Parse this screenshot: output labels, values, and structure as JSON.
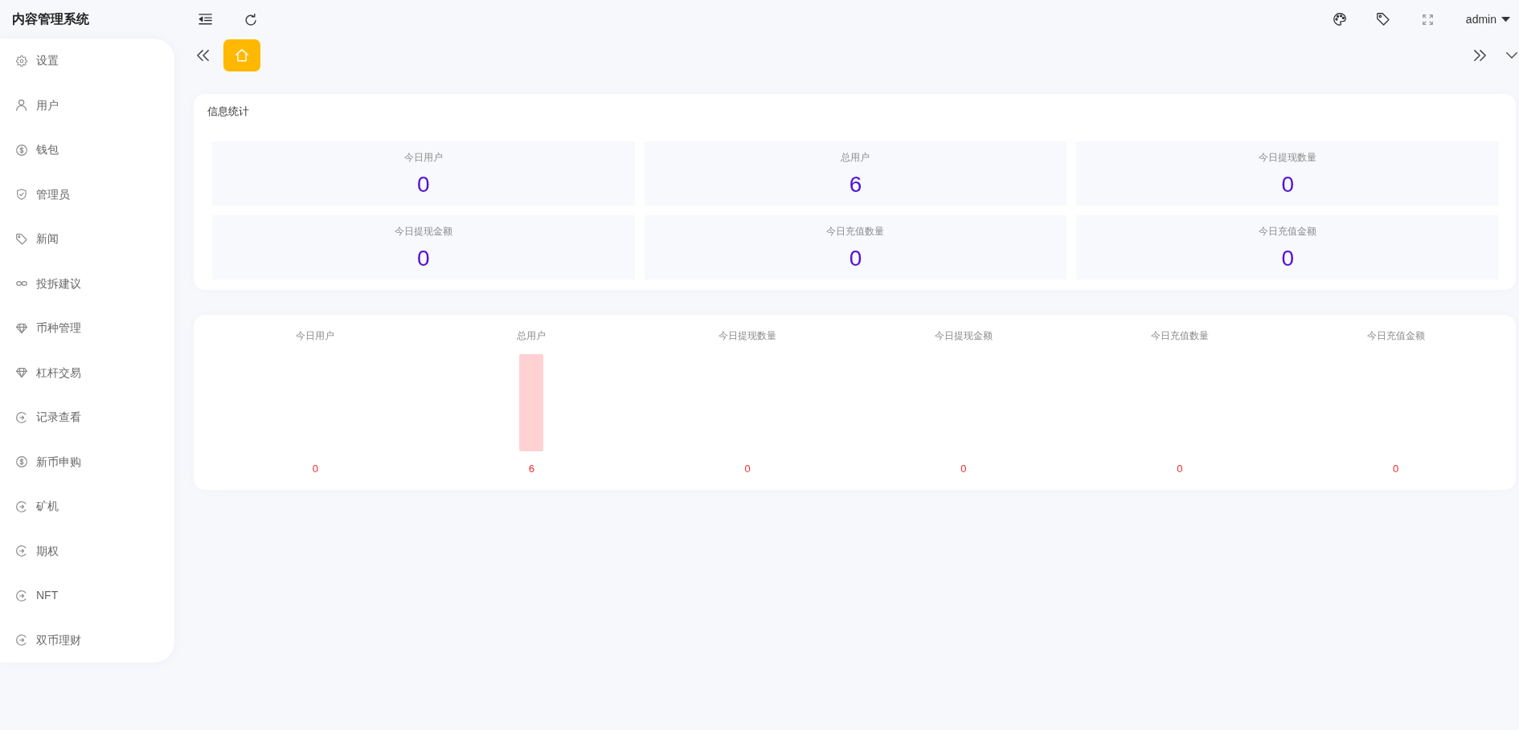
{
  "header": {
    "title": "内容管理系统",
    "user": "admin"
  },
  "sidebar": {
    "items": [
      {
        "label": "设置",
        "kind": "gear",
        "selected": false
      },
      {
        "label": "用户",
        "kind": "user",
        "selected": false
      },
      {
        "label": "钱包",
        "kind": "dollar",
        "selected": false
      },
      {
        "label": "管理员",
        "kind": "shield",
        "selected": false
      },
      {
        "label": "新闻",
        "kind": "tag",
        "selected": false
      },
      {
        "label": "投拆建议",
        "kind": "link",
        "selected": false
      },
      {
        "label": "币种管理",
        "kind": "diamond",
        "selected": false
      },
      {
        "label": "杠杆交易",
        "kind": "diamond",
        "selected": false
      },
      {
        "label": "记录查看",
        "kind": "exit",
        "selected": false
      },
      {
        "label": "新币申购",
        "kind": "dollar",
        "selected": false
      },
      {
        "label": "矿机",
        "kind": "exit",
        "selected": false
      },
      {
        "label": "期权",
        "kind": "exit",
        "selected": false
      },
      {
        "label": "NFT",
        "kind": "exit",
        "selected": false
      },
      {
        "label": "双币理财",
        "kind": "exit",
        "selected": false
      }
    ]
  },
  "tabs": [
    {
      "kind": "home",
      "selected": true
    }
  ],
  "stats": {
    "title": "信息统计",
    "tiles": [
      {
        "label": "今日用户",
        "value": "0"
      },
      {
        "label": "总用户",
        "value": "6"
      },
      {
        "label": "今日提现数量",
        "value": "0"
      },
      {
        "label": "今日提现金额",
        "value": "0"
      },
      {
        "label": "今日充值数量",
        "value": "0"
      },
      {
        "label": "今日充值金额",
        "value": "0"
      }
    ]
  },
  "chart_panel": {
    "chart_data": {
      "type": "bar",
      "categories": [
        "今日用户",
        "总用户",
        "今日提现数量",
        "今日提现金额",
        "今日充值数量",
        "今日充值金额"
      ],
      "values": [
        0,
        6,
        0,
        0,
        0,
        0
      ],
      "data_labels": true
    }
  }
}
